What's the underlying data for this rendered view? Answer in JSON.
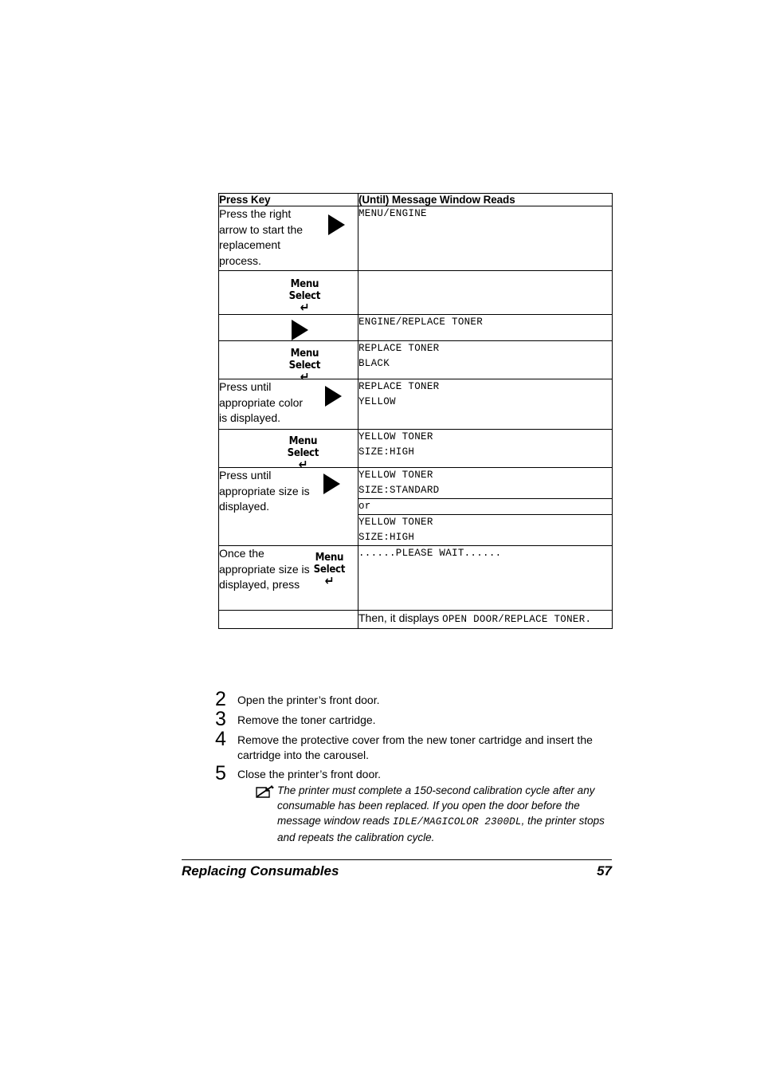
{
  "table": {
    "headers": [
      "Press Key",
      "(Until) Message Window Reads"
    ],
    "rows": [
      {
        "key_text": "Press the right arrow to start the replacement process.",
        "key_glyph": "right-arrow-key",
        "message": "MENU/ENGINE"
      },
      {
        "key_text": "",
        "key_glyph": "menu-select-key",
        "key_label_line1": "Menu",
        "key_label_line2": "Select",
        "message": ""
      },
      {
        "key_text": "",
        "key_glyph": "right-arrow-key",
        "message": "ENGINE/REPLACE TONER"
      },
      {
        "key_text": "",
        "key_glyph": "menu-select-key",
        "key_label_line1": "Menu",
        "key_label_line2": "Select",
        "message": "REPLACE TONER\nBLACK"
      },
      {
        "key_text": "Press until appropriate color is displayed.",
        "key_glyph": "right-arrow-key",
        "message": "REPLACE TONER\nYELLOW"
      },
      {
        "key_text": "",
        "key_glyph": "menu-select-key",
        "key_label_line1": "Menu",
        "key_label_line2": "Select",
        "message": "YELLOW TONER\nSIZE:HIGH"
      },
      {
        "key_text": "Press until appropriate size is displayed.",
        "key_glyph": "right-arrow-key",
        "message": "YELLOW TONER\nSIZE:STANDARD"
      },
      {
        "key_text": "",
        "key_glyph": "",
        "message": "or"
      },
      {
        "key_text": "",
        "key_glyph": "",
        "message": "YELLOW TONER\nSIZE:HIGH"
      },
      {
        "key_text": "Once the appropriate size is displayed, press",
        "key_glyph": "menu-select-key",
        "key_label_line1": "Menu",
        "key_label_line2": "Select",
        "message": "......PLEASE WAIT......"
      },
      {
        "key_text": "",
        "key_glyph": "",
        "message_lead": "Then, it displays ",
        "message": "OPEN DOOR/REPLACE TONER."
      }
    ]
  },
  "steps": [
    {
      "number": "2",
      "text": "Open the printer’s front door."
    },
    {
      "number": "3",
      "text": "Remove the toner cartridge."
    },
    {
      "number": "4",
      "text": "Remove the protective cover from the new toner cartridge and insert the cartridge into the carousel."
    },
    {
      "number": "5",
      "text": "Close the printer’s front door."
    }
  ],
  "note": {
    "icon": "note-pencil-icon",
    "part1": "The printer must complete a 150-second calibration cycle after any consumable has been replaced. If you open the door before the message window reads ",
    "mono": "IDLE/MAGICOLOR 2300DL",
    "part2": ", the printer stops and repeats the calibration cycle."
  },
  "footer": {
    "title": "Replacing Consumables",
    "page": "57"
  }
}
